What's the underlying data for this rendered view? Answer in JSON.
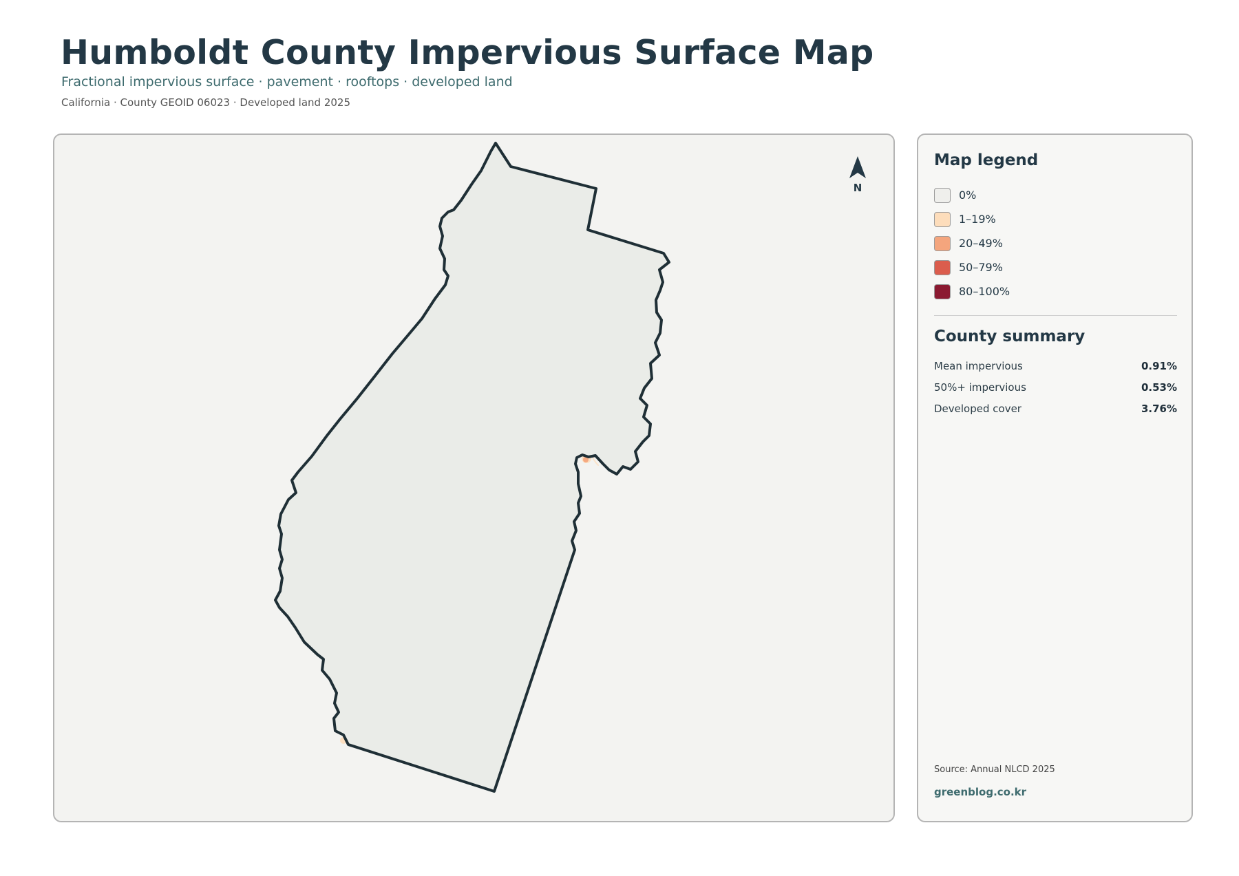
{
  "header": {
    "title": "Humboldt County Impervious Surface Map",
    "subtitle": "Fractional impervious surface · pavement · rooftops · developed land",
    "meta": "California · County GEOID 06023 · Developed land 2025"
  },
  "map": {
    "north_label": "N",
    "county_fill": "#eaece8",
    "boundary_color": "#1f2f36"
  },
  "legend": {
    "title": "Map legend",
    "items": [
      {
        "label": "0%",
        "color": "#efefec"
      },
      {
        "label": "1–19%",
        "color": "#fdddbb"
      },
      {
        "label": "20–49%",
        "color": "#f4a57d"
      },
      {
        "label": "50–79%",
        "color": "#db5d4d"
      },
      {
        "label": "80–100%",
        "color": "#8b1a31"
      }
    ]
  },
  "summary": {
    "title": "County summary",
    "stats": [
      {
        "label": "Mean impervious",
        "value": "0.91%"
      },
      {
        "label": "50%+ impervious",
        "value": "0.53%"
      },
      {
        "label": "Developed cover",
        "value": "3.76%"
      }
    ]
  },
  "footer": {
    "source": "Source: Annual NLCD 2025",
    "site": "greenblog.co.kr"
  }
}
